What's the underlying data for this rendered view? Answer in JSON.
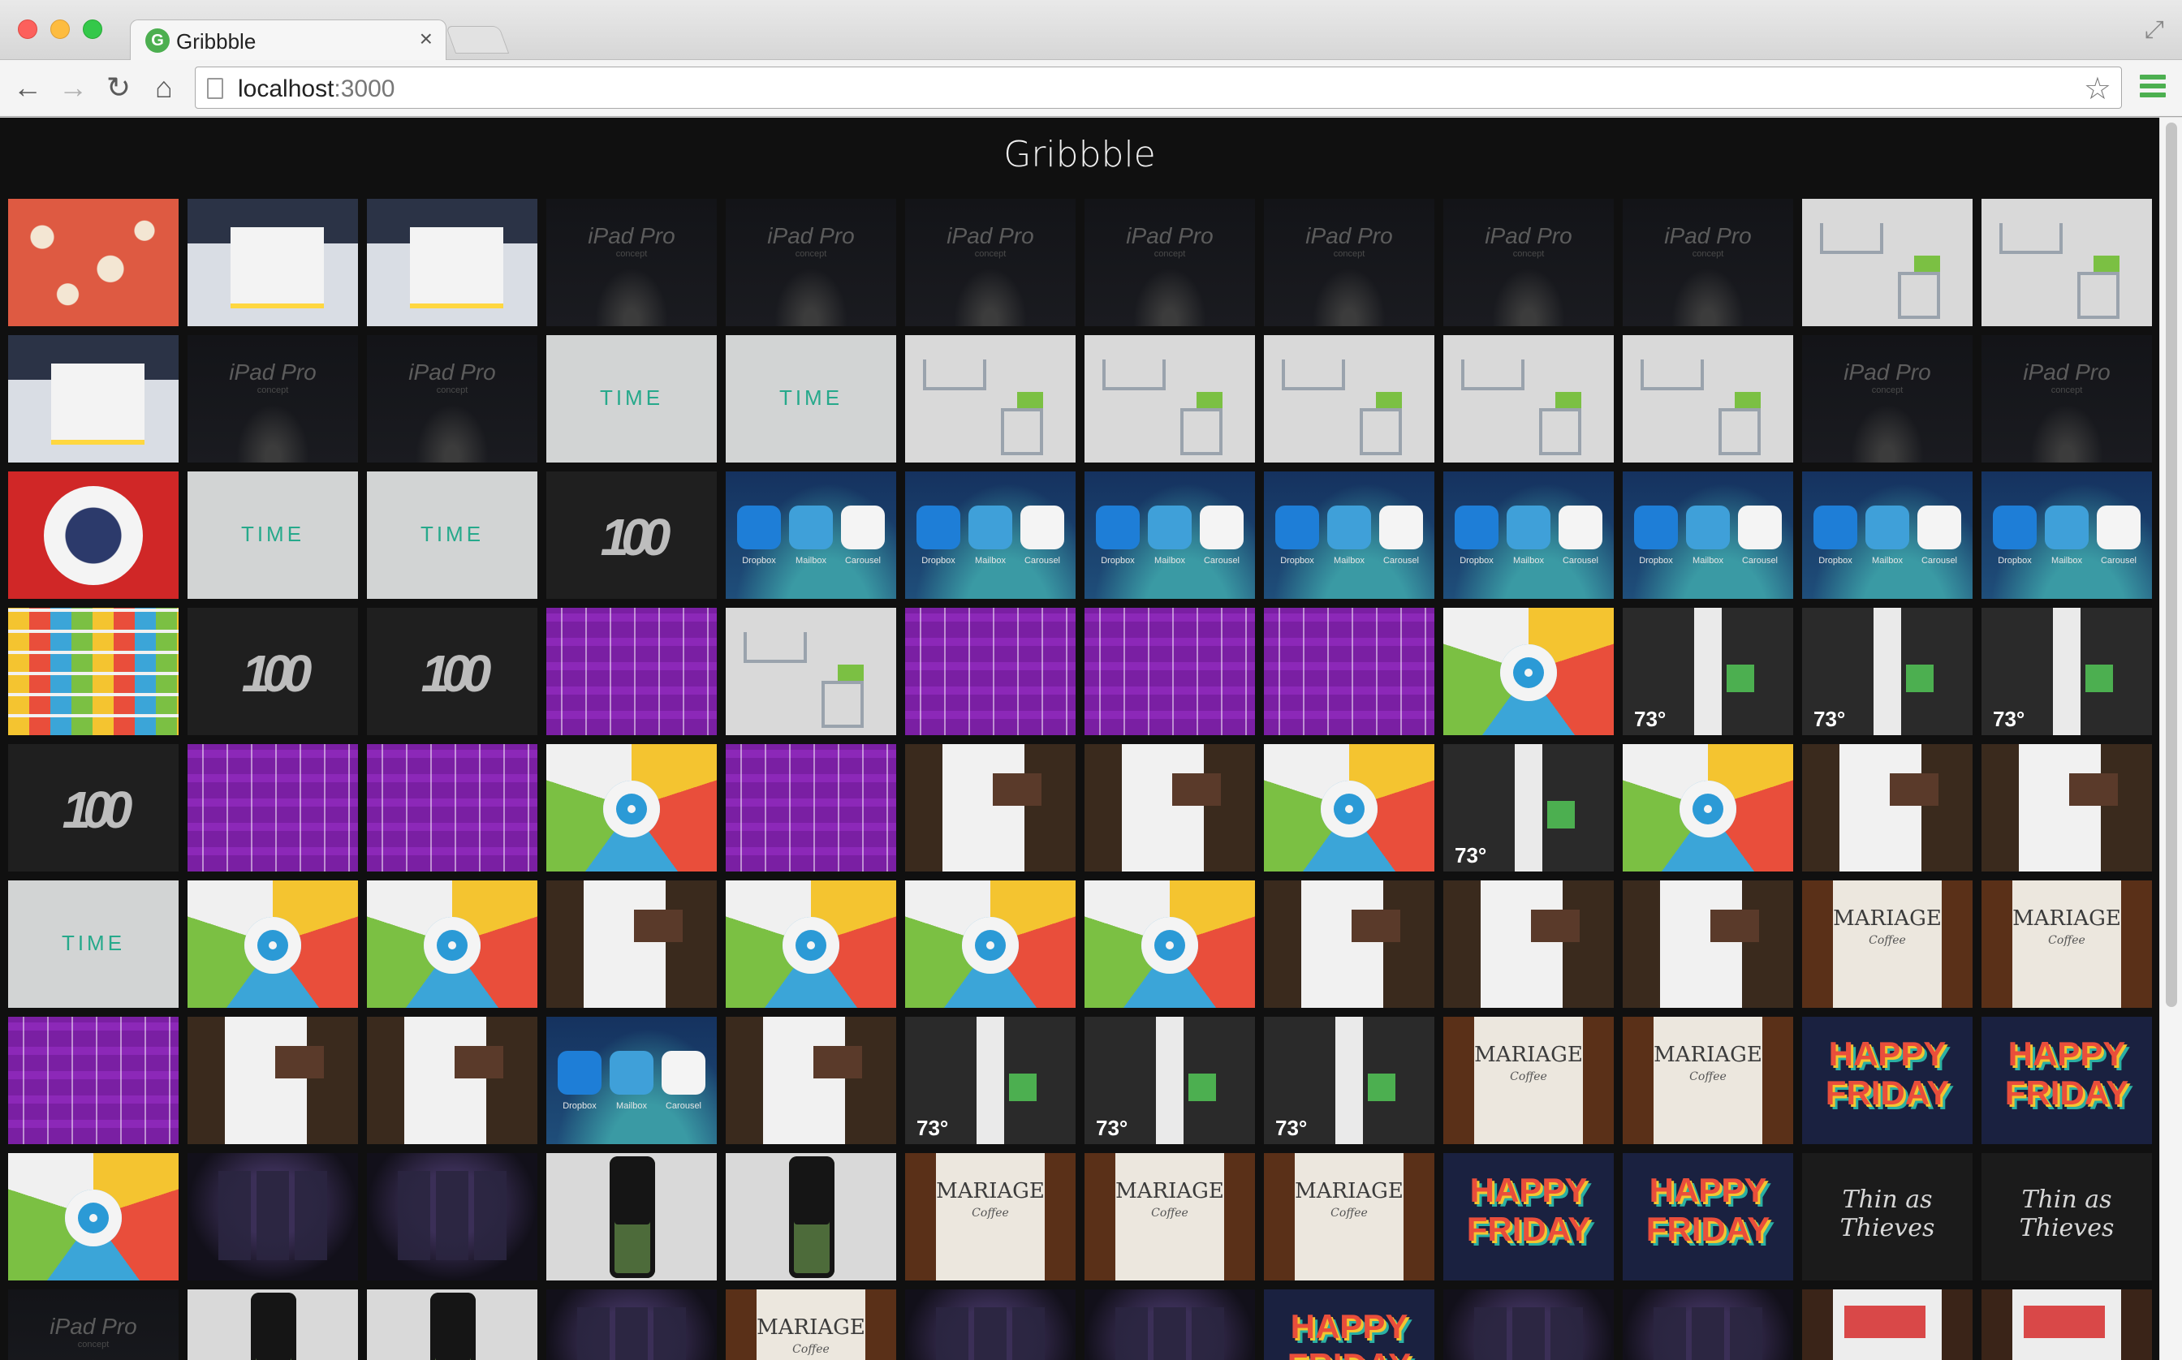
{
  "browser": {
    "tab_title": "Gribbble",
    "favicon_letter": "G",
    "tab_close": "×",
    "url_host": "localhost",
    "url_port": ":3000",
    "icons": {
      "back": "←",
      "forward": "→",
      "reload": "↻",
      "home": "⌂",
      "star": "☆",
      "expand": "⤢"
    }
  },
  "page": {
    "title": "Gribbble"
  },
  "shot_labels": {
    "ipad": "iPad Pro",
    "ipad_sub": "concept",
    "time": "TIME",
    "dropbox": "Dropbox",
    "mailbox": "Mailbox",
    "carousel": "Carousel",
    "temp": "73°",
    "mariage": "MARIAGE",
    "mariage_sub": "Coffee",
    "happy": "HAPPY FRIDAY",
    "thin": "Thin as Thieves"
  },
  "grid": {
    "columns": 12,
    "rows": [
      [
        "rabbits",
        "web",
        "web",
        "ipad",
        "ipad",
        "ipad",
        "ipad",
        "ipad",
        "ipad",
        "ipad",
        "interior",
        "interior"
      ],
      [
        "web",
        "ipad",
        "ipad",
        "time",
        "time",
        "interior",
        "interior",
        "interior",
        "interior",
        "interior",
        "ipad",
        "ipad"
      ],
      [
        "helmet",
        "time",
        "time",
        "hundred",
        "apps",
        "apps",
        "apps",
        "apps",
        "apps",
        "apps",
        "apps",
        "apps"
      ],
      [
        "color",
        "hundred",
        "hundred",
        "icons",
        "interior",
        "icons",
        "icons",
        "icons",
        "mailbox",
        "phone",
        "phone",
        "phone"
      ],
      [
        "hundred",
        "icons",
        "icons",
        "mailbox",
        "icons",
        "brown",
        "brown",
        "mailbox",
        "phone",
        "mailbox",
        "brown",
        "brown"
      ],
      [
        "time",
        "mailbox",
        "mailbox",
        "brown",
        "mailbox",
        "mailbox",
        "mailbox",
        "brown",
        "brown",
        "brown",
        "mariage",
        "mariage"
      ],
      [
        "icons",
        "brown",
        "brown",
        "apps",
        "brown",
        "phone",
        "phone",
        "phone",
        "mariage",
        "mariage",
        "happy",
        "happy"
      ],
      [
        "mailbox",
        "darkui",
        "darkui",
        "iphone",
        "iphone",
        "mariage",
        "mariage",
        "mariage",
        "happy",
        "happy",
        "thin",
        "thin"
      ],
      [
        "ipad",
        "iphone",
        "iphone",
        "darkui",
        "mariage",
        "darkui",
        "darkui",
        "happy",
        "darkui",
        "darkui",
        "poster",
        "poster"
      ]
    ]
  }
}
